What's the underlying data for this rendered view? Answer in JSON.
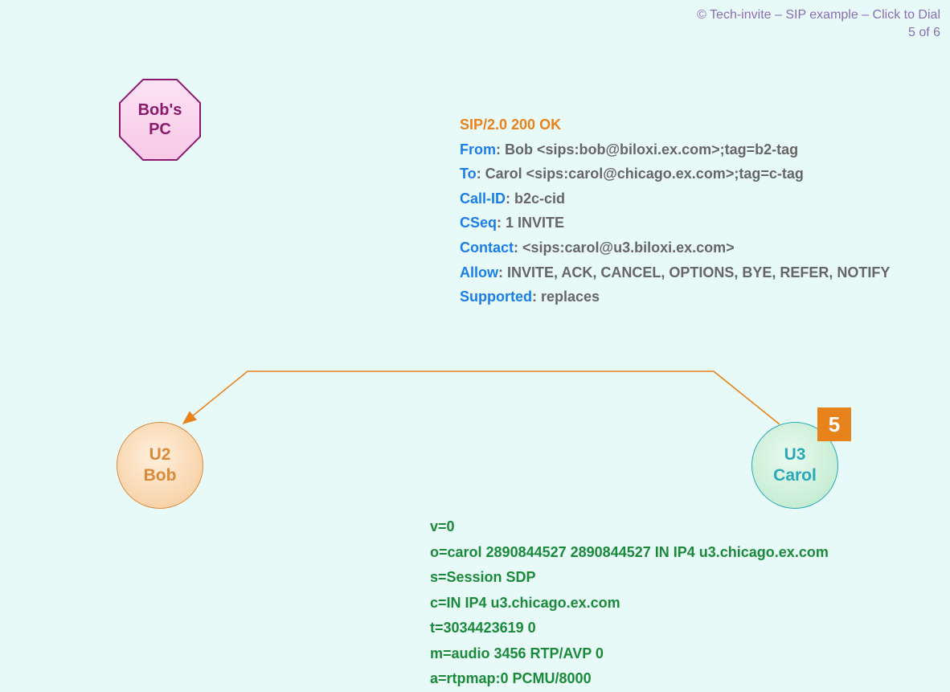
{
  "copyright": {
    "line1": "© Tech-invite – SIP example – Click to Dial",
    "line2": "5 of 6"
  },
  "nodes": {
    "bobs_pc": {
      "line1": "Bob's",
      "line2": "PC"
    },
    "u2": {
      "line1": "U2",
      "line2": "Bob"
    },
    "u3": {
      "line1": "U3",
      "line2": "Carol"
    }
  },
  "step_badge": "5",
  "sip": {
    "status": "SIP/2.0 200 OK",
    "from_key": "From",
    "from_val": ": Bob <sips:bob@biloxi.ex.com>;tag=b2-tag",
    "to_key": "To",
    "to_val": ": Carol <sips:carol@chicago.ex.com>;tag=c-tag",
    "callid_key": "Call-ID",
    "callid_val": ": b2c-cid",
    "cseq_key": "CSeq",
    "cseq_val": ": 1 INVITE",
    "contact_key": "Contact",
    "contact_val": ": <sips:carol@u3.biloxi.ex.com>",
    "allow_key": "Allow",
    "allow_val": ": INVITE, ACK, CANCEL, OPTIONS, BYE, REFER, NOTIFY",
    "supported_key": "Supported",
    "supported_val": ": replaces"
  },
  "sdp": {
    "l1": "v=0",
    "l2": "o=carol  2890844527  2890844527  IN  IP4  u3.chicago.ex.com",
    "l3": "s=Session SDP",
    "l4": "c=IN  IP4  u3.chicago.ex.com",
    "l5": "t=3034423619  0",
    "l6": "m=audio  3456  RTP/AVP  0",
    "l7": "a=rtpmap:0  PCMU/8000"
  }
}
